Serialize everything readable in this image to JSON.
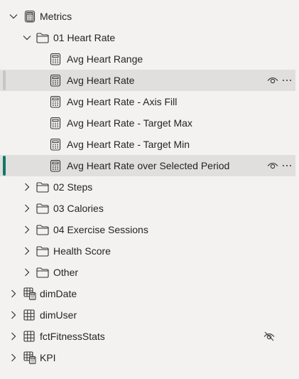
{
  "tree": {
    "metrics_folder": "Metrics",
    "heart_rate_folder": "01 Heart Rate",
    "measures": [
      "Avg Heart Range",
      "Avg Heart Rate",
      "Avg Heart Rate - Axis Fill",
      "Avg Heart Rate - Target Max",
      "Avg Heart Rate - Target Min",
      "Avg Heart Rate over Selected Period"
    ],
    "subfolders": [
      "02 Steps",
      "03 Calories",
      "04 Exercise Sessions",
      "Health Score",
      "Other"
    ],
    "tables": [
      "dimDate",
      "dimUser",
      "fctFitnessStats",
      "KPI"
    ]
  },
  "colors": {
    "background": "#f3f2f1",
    "selected_row": "#e1dfdd",
    "hover_indicator": "#c8c6c4",
    "active_indicator": "#117865",
    "text": "#252423",
    "icon": "#323130"
  }
}
